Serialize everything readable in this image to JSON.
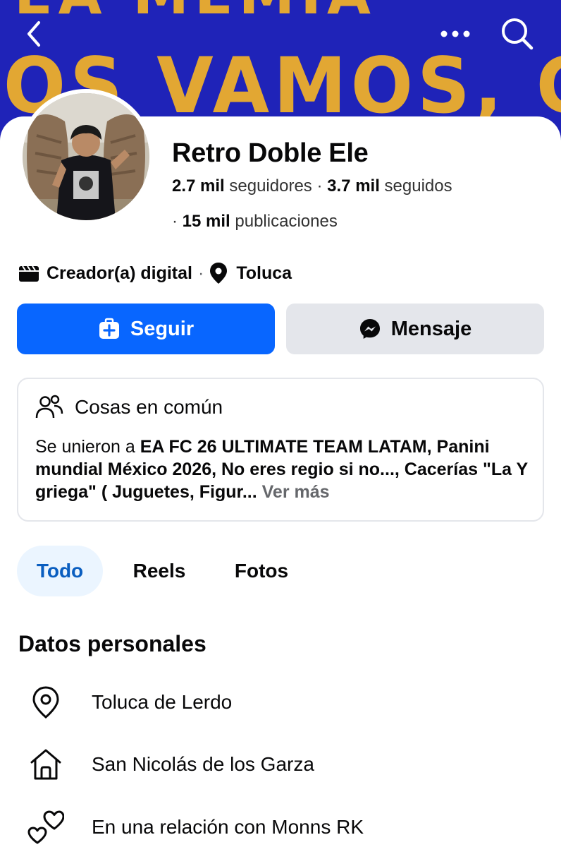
{
  "cover": {
    "text_main": "IOS VAMOS, GORD",
    "text_top": "EA MEMIA",
    "colors": {
      "background": "#1f23b8",
      "text": "#e2a733"
    }
  },
  "top_bar": {
    "back_icon": "chevron-left-icon",
    "more_icon": "more-dots-icon",
    "search_icon": "search-icon"
  },
  "profile": {
    "name": "Retro Doble Ele",
    "followers_count": "2.7 mil",
    "followers_label": "seguidores",
    "separator": "·",
    "following_count": "3.7 mil",
    "following_label": "seguidos",
    "posts_prefix": "·",
    "posts_count": "15 mil",
    "posts_label": "publicaciones"
  },
  "meta": {
    "category": "Creador(a) digital",
    "separator": "·",
    "location": "Toluca"
  },
  "actions": {
    "follow_label": "Seguir",
    "message_label": "Mensaje",
    "colors": {
      "follow": "#0866ff",
      "message": "#e4e6eb"
    }
  },
  "common": {
    "title": "Cosas en común",
    "prefix": "Se unieron a ",
    "groups_text": "EA FC 26 ULTIMATE TEAM LATAM, Panini mundial México 2026, No eres regio si no..., Cacerías \"La Y griega\" ( Juguetes, Figur...",
    "see_more": " Ver más"
  },
  "tabs": [
    {
      "label": "Todo",
      "active": true
    },
    {
      "label": "Reels",
      "active": false
    },
    {
      "label": "Fotos",
      "active": false
    }
  ],
  "personal": {
    "title": "Datos personales",
    "items": [
      {
        "icon": "location-pin-icon",
        "text": "Toluca de Lerdo"
      },
      {
        "icon": "home-icon",
        "text": "San Nicolás de los Garza"
      },
      {
        "icon": "hearts-icon",
        "text": "En una relación con Monns RK"
      }
    ]
  }
}
